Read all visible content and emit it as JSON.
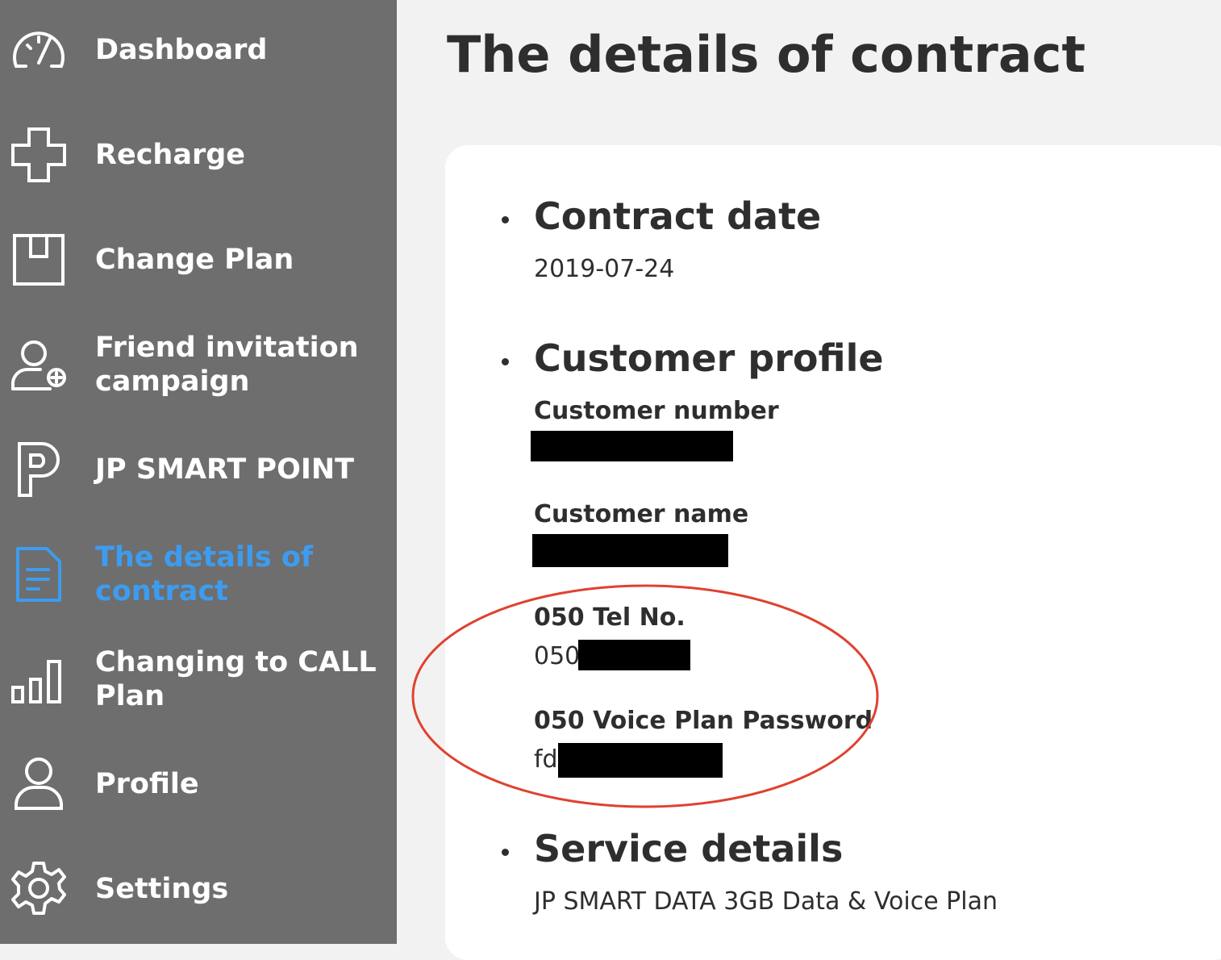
{
  "sidebar": {
    "items": [
      {
        "label": "Dashboard",
        "icon": "speedometer-icon"
      },
      {
        "label": "Recharge",
        "icon": "plus-icon"
      },
      {
        "label": "Change Plan",
        "icon": "box-icon"
      },
      {
        "label": "Friend invitation campaign",
        "icon": "add-user-icon"
      },
      {
        "label": "JP SMART POINT",
        "icon": "point-p-icon"
      },
      {
        "label": "The details of contract",
        "icon": "document-icon",
        "active": true
      },
      {
        "label": "Changing to CALL Plan",
        "icon": "bar-chart-icon"
      },
      {
        "label": "Profile",
        "icon": "user-icon"
      },
      {
        "label": "Settings",
        "icon": "gear-icon"
      }
    ],
    "active_color": "#3d9cf0",
    "background": "#6e6e6e"
  },
  "main": {
    "title": "The details of contract",
    "sections": {
      "contract_date": {
        "title": "Contract date",
        "value": "2019-07-24"
      },
      "customer_profile": {
        "title": "Customer profile",
        "customer_number_label": "Customer number",
        "customer_name_label": "Customer name",
        "tel_label": "050 Tel No.",
        "tel_value_prefix": "050",
        "password_label": "050 Voice Plan Password",
        "password_value_prefix": "fd"
      },
      "service_details": {
        "title": "Service details",
        "value": "JP SMART DATA 3GB Data & Voice Plan"
      }
    },
    "highlight_color": "#e0412f"
  }
}
